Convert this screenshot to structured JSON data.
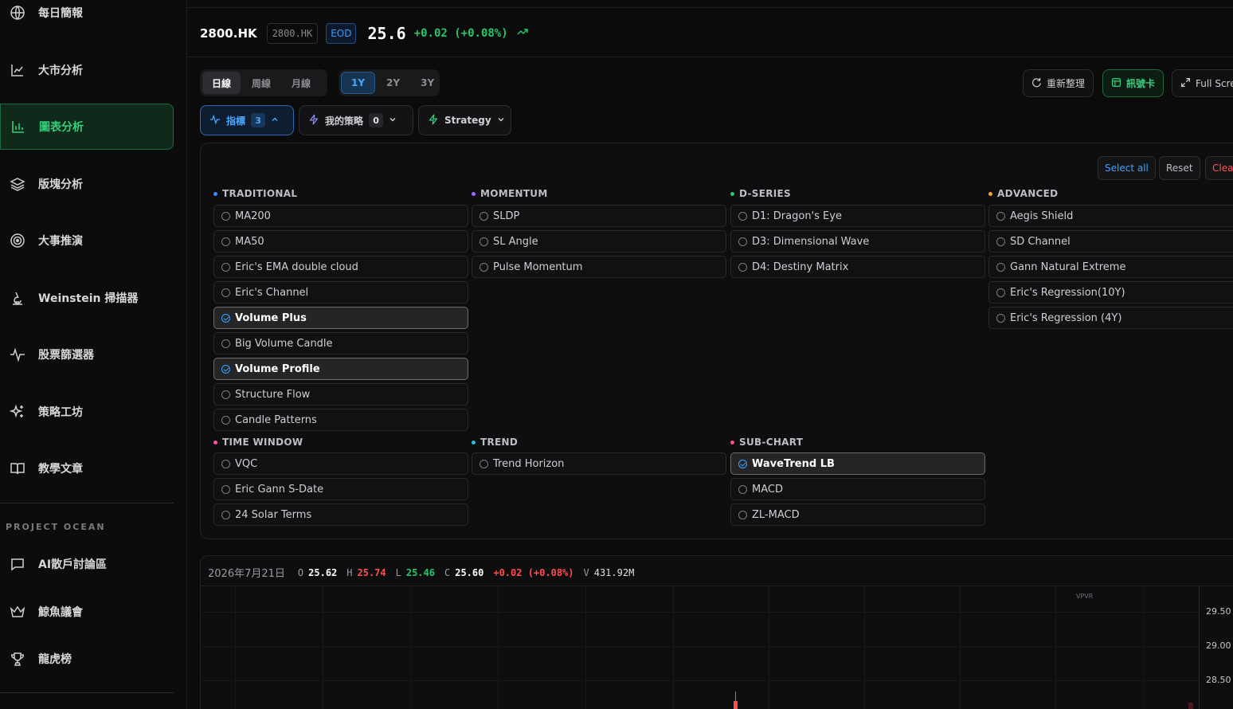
{
  "sidebar": {
    "items": [
      {
        "label": "每日簡報",
        "icon": "globe-icon"
      },
      {
        "label": "大市分析",
        "icon": "line-chart-icon"
      },
      {
        "label": "圖表分析",
        "icon": "bar-chart-icon"
      },
      {
        "label": "版塊分析",
        "icon": "layers-icon"
      },
      {
        "label": "大事推演",
        "icon": "target-icon"
      },
      {
        "label": "Weinstein 掃描器",
        "icon": "microscope-icon"
      },
      {
        "label": "股票篩選器",
        "icon": "pulse-icon"
      },
      {
        "label": "策略工坊",
        "icon": "sparkles-icon"
      },
      {
        "label": "教學文章",
        "icon": "book-icon"
      }
    ],
    "section_label": "PROJECT OCEAN",
    "ocean_items": [
      {
        "label": "AI散戶討論區",
        "icon": "chat-icon"
      },
      {
        "label": "鯨魚議會",
        "icon": "crown-icon"
      },
      {
        "label": "龍虎榜",
        "icon": "trophy-icon"
      }
    ]
  },
  "header": {
    "ticker": "2800.HK",
    "ticker_input": "2800.HK",
    "eod": "EOD",
    "price": "25.6",
    "change": "+0.02 (+0.08%)",
    "colors": {
      "up": "#27c66a",
      "accent": "#34d07a",
      "blue": "#3ea3ff",
      "down": "#ff4d4d"
    }
  },
  "toolbar": {
    "intervals": [
      "日線",
      "周線",
      "月線"
    ],
    "ranges": [
      "1Y",
      "2Y",
      "3Y"
    ],
    "refresh": "重新整理",
    "signal_card": "訊號卡",
    "fullscreen": "Full Scre"
  },
  "chips": {
    "indicators": {
      "label": "指標",
      "count": "3"
    },
    "my_strategy": {
      "label": "我的策略",
      "count": "0"
    },
    "strategy": {
      "label": "Strategy"
    }
  },
  "panel": {
    "select_all": "Select all",
    "reset": "Reset",
    "clear": "Clea",
    "categories": [
      {
        "name": "TRADITIONAL",
        "items": [
          "MA200",
          "MA50",
          "Eric's EMA double cloud",
          "Eric's Channel",
          "Volume Plus",
          "Big Volume Candle",
          "Volume Profile",
          "Structure Flow",
          "Candle Patterns"
        ]
      },
      {
        "name": "MOMENTUM",
        "items": [
          "SLDP",
          "SL Angle",
          "Pulse Momentum"
        ]
      },
      {
        "name": "D-SERIES",
        "items": [
          "D1: Dragon's Eye",
          "D3: Dimensional Wave",
          "D4: Destiny Matrix"
        ]
      },
      {
        "name": "ADVANCED",
        "items": [
          "Aegis Shield",
          "SD Channel",
          "Gann Natural Extreme",
          "Eric's Regression(10Y)",
          "Eric's Regression (4Y)"
        ]
      },
      {
        "name": "TIME WINDOW",
        "items": [
          "VQC",
          "Eric Gann S-Date",
          "24 Solar Terms"
        ]
      },
      {
        "name": "TREND",
        "items": [
          "Trend Horizon"
        ]
      },
      {
        "name": "SUB-CHART",
        "items": [
          "WaveTrend LB",
          "MACD",
          "ZL-MACD"
        ]
      }
    ]
  },
  "chart": {
    "date": "2026年7月21日",
    "o_label": "O",
    "o": "25.62",
    "h_label": "H",
    "h": "25.74",
    "l_label": "L",
    "l": "25.46",
    "c_label": "C",
    "c": "25.60",
    "chg": "+0.02 (+0.08%)",
    "v_label": "V",
    "v": "431.92M",
    "vpvr": "VPVR",
    "yticks": [
      "29.50",
      "29.00",
      "28.50"
    ]
  }
}
